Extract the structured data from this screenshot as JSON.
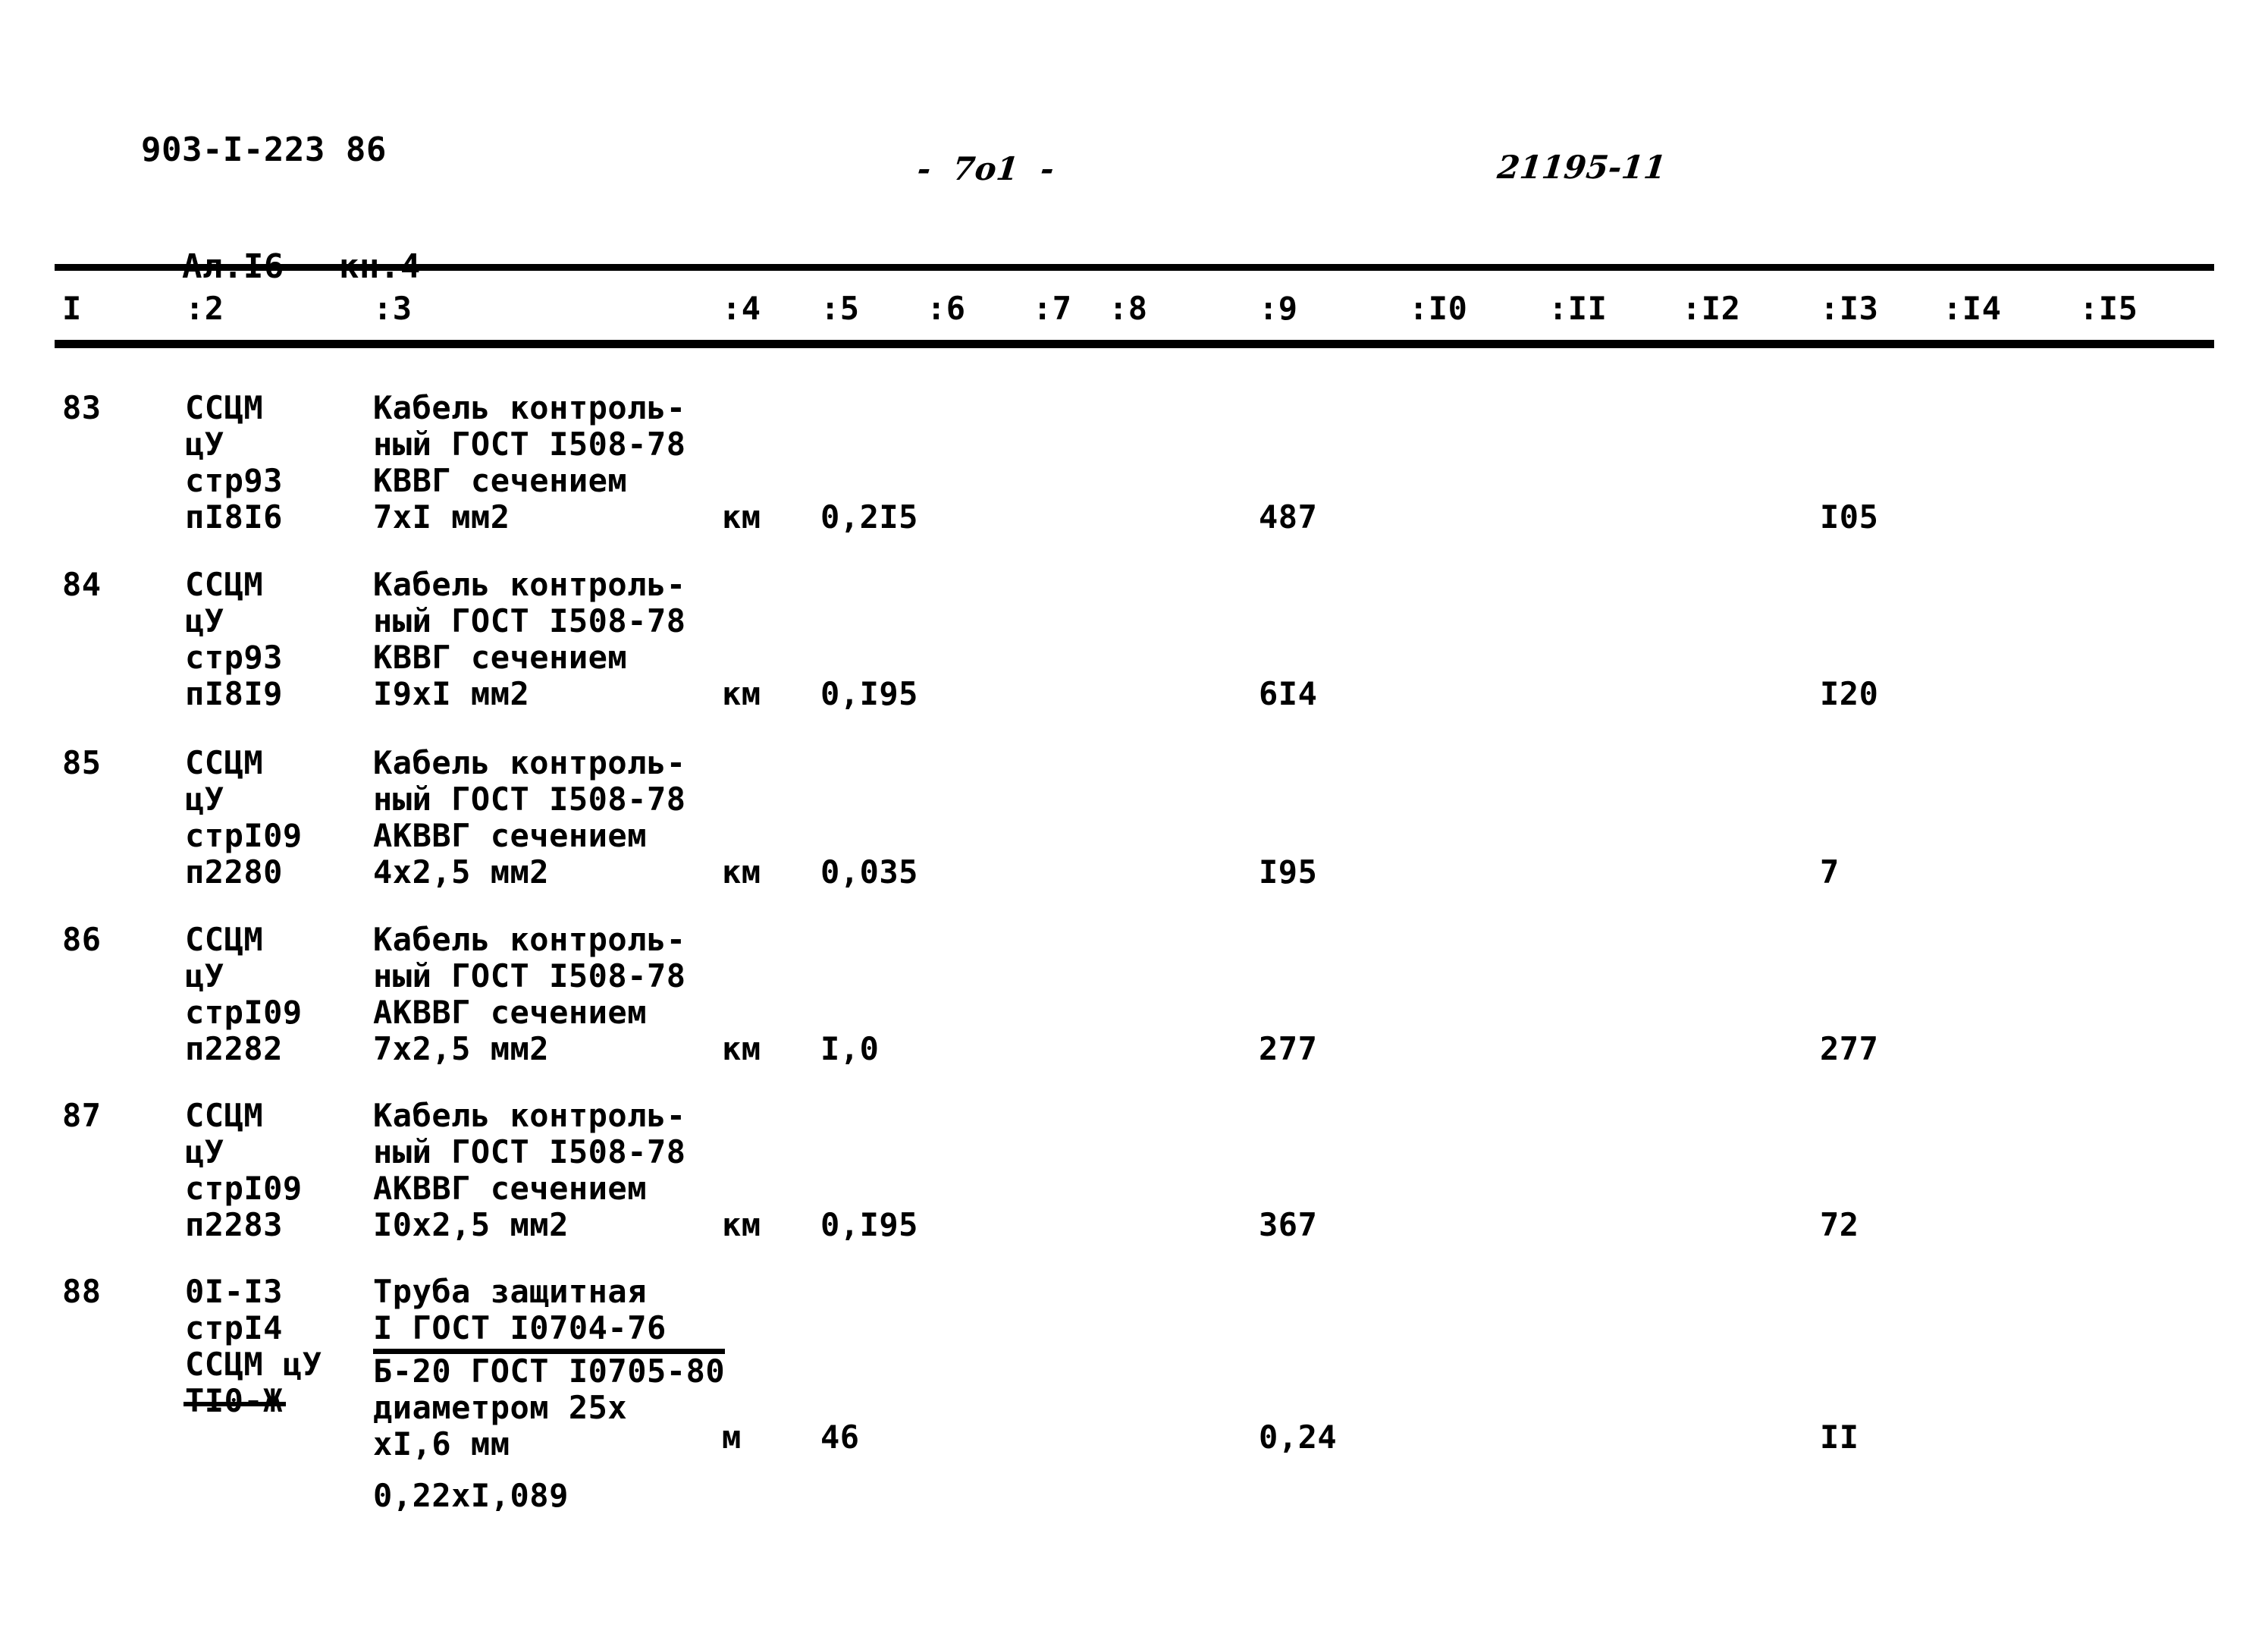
{
  "header": {
    "doc_code": "903-I-223 86",
    "album": "Ал.I6",
    "book": "кн.4",
    "page_number": "-  7o1  -",
    "stamp": "21195-11"
  },
  "table": {
    "column_headers": [
      "I",
      ":2",
      ":3",
      ":4",
      ":5",
      ":6",
      ":7",
      ":8",
      ":9",
      ":I0",
      ":II",
      ":I2",
      ":I3",
      ":I4",
      ":I5"
    ],
    "rows": [
      {
        "num": "83",
        "code_lines": [
          "ССЦМ",
          "цУ",
          "стр93",
          "пI8I6"
        ],
        "name_lines": [
          "Кабель контроль-",
          "ный ГОСТ I508-78",
          "КВВГ сечением",
          "7xI мм2"
        ],
        "unit": "км",
        "qty": "0,2I5",
        "price": "487",
        "total": "I05"
      },
      {
        "num": "84",
        "code_lines": [
          "ССЦМ",
          "цУ",
          "стр93",
          "пI8I9"
        ],
        "name_lines": [
          "Кабель контроль-",
          "ный ГОСТ I508-78",
          "КВВГ сечением",
          "I9xI мм2"
        ],
        "unit": "км",
        "qty": "0,I95",
        "price": "6I4",
        "total": "I20"
      },
      {
        "num": "85",
        "code_lines": [
          "ССЦМ",
          "цУ",
          "стрI09",
          "п2280"
        ],
        "name_lines": [
          "Кабель контроль-",
          "ный ГОСТ I508-78",
          "АКВВГ сечением",
          "4x2,5 мм2"
        ],
        "unit": "км",
        "qty": "0,035",
        "price": "I95",
        "total": "7"
      },
      {
        "num": "86",
        "code_lines": [
          "ССЦМ",
          "цУ",
          "стрI09",
          "п2282"
        ],
        "name_lines": [
          "Кабель контроль-",
          "ный ГОСТ I508-78",
          "АКВВГ сечением",
          "7x2,5 мм2"
        ],
        "unit": "км",
        "qty": "I,0",
        "price": "277",
        "total": "277"
      },
      {
        "num": "87",
        "code_lines": [
          "ССЦМ",
          "цУ",
          "стрI09",
          "п2283"
        ],
        "name_lines": [
          "Кабель контроль-",
          "ный ГОСТ I508-78",
          "АКВВГ сечением",
          "I0x2,5 мм2"
        ],
        "unit": "км",
        "qty": "0,I95",
        "price": "367",
        "total": "72"
      },
      {
        "num": "88",
        "code_lines": [
          "0I-I3",
          "стрI4",
          "ССЦМ цУ",
          "TI0-Ж"
        ],
        "name_lines": [
          "Труба защитная",
          "I ГОСТ I0704-76",
          "Б-20 ГОСТ I0705-80",
          "диаметром 25x",
          "xI,6 мм"
        ],
        "unit": "м",
        "qty": "46",
        "price": "0,24",
        "total": "II",
        "tail_line": "0,22xI,089"
      }
    ]
  }
}
